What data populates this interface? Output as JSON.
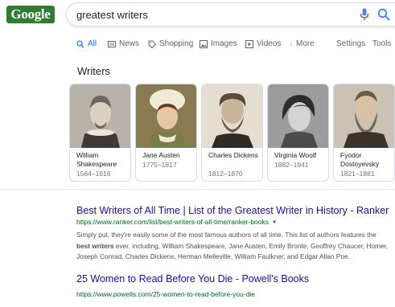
{
  "logo": {
    "text": "Google"
  },
  "search": {
    "query": "greatest writers"
  },
  "tabs": [
    {
      "label": "All",
      "icon": "search-icon",
      "active": true
    },
    {
      "label": "News",
      "icon": "news-icon"
    },
    {
      "label": "Shopping",
      "icon": "tag-icon"
    },
    {
      "label": "Images",
      "icon": "image-icon"
    },
    {
      "label": "Videos",
      "icon": "play-icon"
    },
    {
      "label": "More",
      "icon": "more-vert-icon"
    },
    {
      "label": "Settings"
    },
    {
      "label": "Tools"
    }
  ],
  "panel": {
    "title": "Writers",
    "cards": [
      {
        "name": "William Shakespeare",
        "dates": "1564–1616"
      },
      {
        "name": "Jane Austen",
        "dates": "1775–1817"
      },
      {
        "name": "Charles Dickens",
        "dates": "1812–1870"
      },
      {
        "name": "Virginia Woolf",
        "dates": "1882–1941"
      },
      {
        "name": "Fyodor Dostoyevsky",
        "dates": "1821–1881"
      }
    ]
  },
  "results": [
    {
      "title": "Best Writers of All Time | List of the Greatest Writer in History - Ranker",
      "url": "https://www.ranker.com/list/best-writers-of-all-time/ranker-books",
      "snippet_1": "Simply put, they're easily some of the most famous authors of all time. This list of authors features the",
      "snippet_bold": "best writers",
      "snippet_2": " ever, including, William Shakespeare, Jane Austen, Emily Bronte, Geoffrey Chaucer, Homer,",
      "snippet_3": "Joseph Conrad, Charles Dickens, Herman Melleville, William Faulkner, and Edgar Allan Poe."
    },
    {
      "title": "25 Women to Read Before You Die - Powell's Books",
      "url": "https://www.powells.com/25-women-to-read-before-you-die"
    }
  ],
  "colors": {
    "link": "#1a0dab",
    "url": "#006621",
    "active_tab": "#1a73e8",
    "logo_bg": "#2e7d32"
  }
}
